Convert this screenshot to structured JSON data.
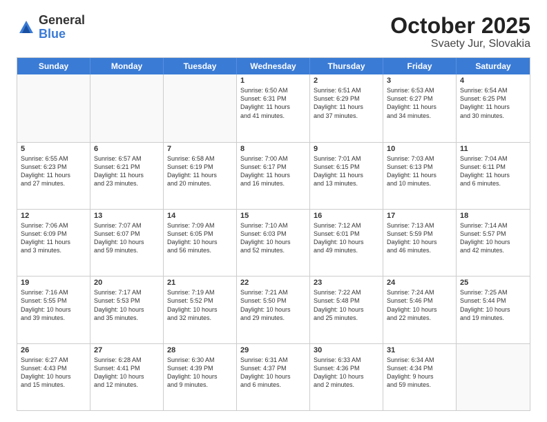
{
  "logo": {
    "general": "General",
    "blue": "Blue"
  },
  "header": {
    "month": "October 2025",
    "location": "Svaety Jur, Slovakia"
  },
  "weekdays": [
    "Sunday",
    "Monday",
    "Tuesday",
    "Wednesday",
    "Thursday",
    "Friday",
    "Saturday"
  ],
  "weeks": [
    [
      {
        "day": "",
        "info": ""
      },
      {
        "day": "",
        "info": ""
      },
      {
        "day": "",
        "info": ""
      },
      {
        "day": "1",
        "info": "Sunrise: 6:50 AM\nSunset: 6:31 PM\nDaylight: 11 hours\nand 41 minutes."
      },
      {
        "day": "2",
        "info": "Sunrise: 6:51 AM\nSunset: 6:29 PM\nDaylight: 11 hours\nand 37 minutes."
      },
      {
        "day": "3",
        "info": "Sunrise: 6:53 AM\nSunset: 6:27 PM\nDaylight: 11 hours\nand 34 minutes."
      },
      {
        "day": "4",
        "info": "Sunrise: 6:54 AM\nSunset: 6:25 PM\nDaylight: 11 hours\nand 30 minutes."
      }
    ],
    [
      {
        "day": "5",
        "info": "Sunrise: 6:55 AM\nSunset: 6:23 PM\nDaylight: 11 hours\nand 27 minutes."
      },
      {
        "day": "6",
        "info": "Sunrise: 6:57 AM\nSunset: 6:21 PM\nDaylight: 11 hours\nand 23 minutes."
      },
      {
        "day": "7",
        "info": "Sunrise: 6:58 AM\nSunset: 6:19 PM\nDaylight: 11 hours\nand 20 minutes."
      },
      {
        "day": "8",
        "info": "Sunrise: 7:00 AM\nSunset: 6:17 PM\nDaylight: 11 hours\nand 16 minutes."
      },
      {
        "day": "9",
        "info": "Sunrise: 7:01 AM\nSunset: 6:15 PM\nDaylight: 11 hours\nand 13 minutes."
      },
      {
        "day": "10",
        "info": "Sunrise: 7:03 AM\nSunset: 6:13 PM\nDaylight: 11 hours\nand 10 minutes."
      },
      {
        "day": "11",
        "info": "Sunrise: 7:04 AM\nSunset: 6:11 PM\nDaylight: 11 hours\nand 6 minutes."
      }
    ],
    [
      {
        "day": "12",
        "info": "Sunrise: 7:06 AM\nSunset: 6:09 PM\nDaylight: 11 hours\nand 3 minutes."
      },
      {
        "day": "13",
        "info": "Sunrise: 7:07 AM\nSunset: 6:07 PM\nDaylight: 10 hours\nand 59 minutes."
      },
      {
        "day": "14",
        "info": "Sunrise: 7:09 AM\nSunset: 6:05 PM\nDaylight: 10 hours\nand 56 minutes."
      },
      {
        "day": "15",
        "info": "Sunrise: 7:10 AM\nSunset: 6:03 PM\nDaylight: 10 hours\nand 52 minutes."
      },
      {
        "day": "16",
        "info": "Sunrise: 7:12 AM\nSunset: 6:01 PM\nDaylight: 10 hours\nand 49 minutes."
      },
      {
        "day": "17",
        "info": "Sunrise: 7:13 AM\nSunset: 5:59 PM\nDaylight: 10 hours\nand 46 minutes."
      },
      {
        "day": "18",
        "info": "Sunrise: 7:14 AM\nSunset: 5:57 PM\nDaylight: 10 hours\nand 42 minutes."
      }
    ],
    [
      {
        "day": "19",
        "info": "Sunrise: 7:16 AM\nSunset: 5:55 PM\nDaylight: 10 hours\nand 39 minutes."
      },
      {
        "day": "20",
        "info": "Sunrise: 7:17 AM\nSunset: 5:53 PM\nDaylight: 10 hours\nand 35 minutes."
      },
      {
        "day": "21",
        "info": "Sunrise: 7:19 AM\nSunset: 5:52 PM\nDaylight: 10 hours\nand 32 minutes."
      },
      {
        "day": "22",
        "info": "Sunrise: 7:21 AM\nSunset: 5:50 PM\nDaylight: 10 hours\nand 29 minutes."
      },
      {
        "day": "23",
        "info": "Sunrise: 7:22 AM\nSunset: 5:48 PM\nDaylight: 10 hours\nand 25 minutes."
      },
      {
        "day": "24",
        "info": "Sunrise: 7:24 AM\nSunset: 5:46 PM\nDaylight: 10 hours\nand 22 minutes."
      },
      {
        "day": "25",
        "info": "Sunrise: 7:25 AM\nSunset: 5:44 PM\nDaylight: 10 hours\nand 19 minutes."
      }
    ],
    [
      {
        "day": "26",
        "info": "Sunrise: 6:27 AM\nSunset: 4:43 PM\nDaylight: 10 hours\nand 15 minutes."
      },
      {
        "day": "27",
        "info": "Sunrise: 6:28 AM\nSunset: 4:41 PM\nDaylight: 10 hours\nand 12 minutes."
      },
      {
        "day": "28",
        "info": "Sunrise: 6:30 AM\nSunset: 4:39 PM\nDaylight: 10 hours\nand 9 minutes."
      },
      {
        "day": "29",
        "info": "Sunrise: 6:31 AM\nSunset: 4:37 PM\nDaylight: 10 hours\nand 6 minutes."
      },
      {
        "day": "30",
        "info": "Sunrise: 6:33 AM\nSunset: 4:36 PM\nDaylight: 10 hours\nand 2 minutes."
      },
      {
        "day": "31",
        "info": "Sunrise: 6:34 AM\nSunset: 4:34 PM\nDaylight: 9 hours\nand 59 minutes."
      },
      {
        "day": "",
        "info": ""
      }
    ]
  ]
}
